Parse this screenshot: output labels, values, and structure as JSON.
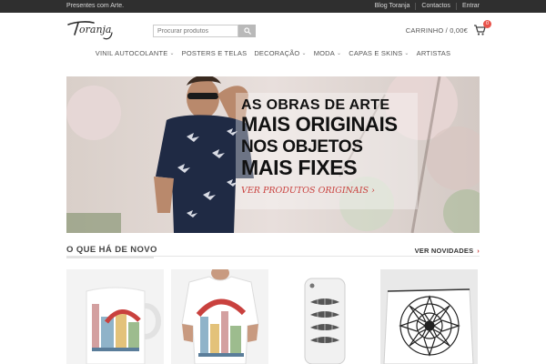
{
  "topbar": {
    "tagline": "Presentes com Arte.",
    "links": [
      "Blog Toranja",
      "Contactos",
      "Entrar"
    ]
  },
  "header": {
    "logo_text": "Toranja",
    "search_placeholder": "Procurar produtos",
    "cart_label": "CARRINHO / 0,00€",
    "cart_count": "0"
  },
  "nav": {
    "items": [
      {
        "label": "VINIL AUTOCOLANTE",
        "dropdown": true
      },
      {
        "label": "POSTERS E TELAS",
        "dropdown": false
      },
      {
        "label": "DECORAÇÃO",
        "dropdown": true
      },
      {
        "label": "MODA",
        "dropdown": true
      },
      {
        "label": "CAPAS E SKINS",
        "dropdown": true
      },
      {
        "label": "ARTISTAS",
        "dropdown": false
      }
    ]
  },
  "hero": {
    "line1": "AS OBRAS DE ARTE",
    "line2": "MAIS ORIGINAIS",
    "line3": "NOS OBJETOS",
    "line4": "MAIS FIXES",
    "cta": "VER PRODUTOS ORIGINAIS ›"
  },
  "section": {
    "title": "O QUE HÁ DE NOVO",
    "more_label": "VER NOVIDADES",
    "more_arrow": "›"
  },
  "colors": {
    "topbar_bg": "#2f2f2f",
    "accent": "#c9413e",
    "badge": "#e8534b"
  },
  "products": [
    {
      "name": "mug-product-image"
    },
    {
      "name": "tshirt-product-image"
    },
    {
      "name": "phone-case-product-image"
    },
    {
      "name": "pouch-product-image"
    }
  ]
}
